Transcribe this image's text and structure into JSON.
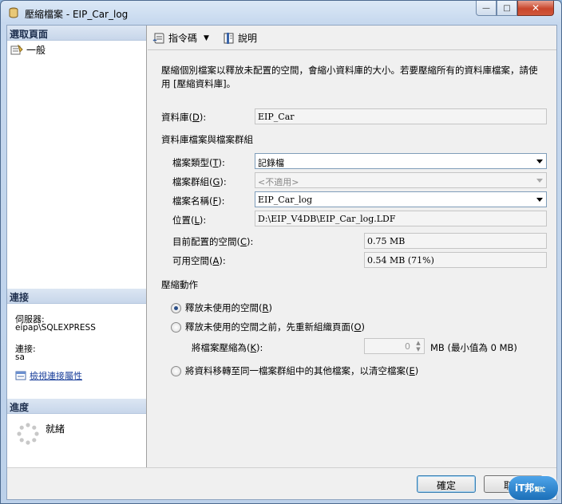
{
  "window": {
    "title": "壓縮檔案 - EIP_Car_log",
    "minimize": "—",
    "maximize": "□",
    "close": "✕"
  },
  "left": {
    "select_page_header": "選取頁面",
    "pages": [
      {
        "label": "一般"
      }
    ],
    "connection_header": "連接",
    "server_label": "伺服器:",
    "server_value": "eipap\\SQLEXPRESS",
    "connection_label": "連接:",
    "connection_value": "sa",
    "view_conn_props": "檢視連接屬性",
    "progress_header": "進度",
    "progress_status": "就緒"
  },
  "toolbar": {
    "script_label": "指令碼",
    "help_label": "說明"
  },
  "description": "壓縮個別檔案以釋放未配置的空間，會縮小資料庫的大小。若要壓縮所有的資料庫檔案，請使用 [壓縮資料庫]。",
  "database": {
    "label": "資料庫(",
    "hotkey": "D",
    "label_end": "):",
    "value": "EIP_Car"
  },
  "files_group": {
    "title": "資料庫檔案與檔案群組",
    "file_type_label": "檔案類型(",
    "file_type_key": "T",
    "file_type_end": "):",
    "file_type_value": "記錄檔",
    "filegroup_label": "檔案群組(",
    "filegroup_key": "G",
    "filegroup_end": "):",
    "filegroup_value": "<不適用>",
    "file_name_label": "檔案名稱(",
    "file_name_key": "F",
    "file_name_end": "):",
    "file_name_value": "EIP_Car_log",
    "location_label": "位置(",
    "location_key": "L",
    "location_end": "):",
    "location_value": "D:\\EIP_V4DB\\EIP_Car_log.LDF",
    "allocated_label": "目前配置的空間(",
    "allocated_key": "C",
    "allocated_end": "):",
    "allocated_value": "0.75 MB",
    "available_label": "可用空間(",
    "available_key": "A",
    "available_end": "):",
    "available_value": "0.54 MB (71%)"
  },
  "shrink_action": {
    "title": "壓縮動作",
    "option1": "釋放未使用的空間(",
    "option1_key": "R",
    "option1_end": ")",
    "option2": "釋放未使用的空間之前，先重新組織頁面(",
    "option2_key": "O",
    "option2_end": ")",
    "shrink_to_label": "將檔案壓縮為(",
    "shrink_to_key": "K",
    "shrink_to_end": "):",
    "shrink_to_value": "0",
    "shrink_to_unit": "MB (最小值為 0 MB)",
    "option3": "將資料移轉至同一檔案群組中的其他檔案，以清空檔案(",
    "option3_key": "E",
    "option3_end": ")",
    "selected": 1
  },
  "buttons": {
    "ok": "確定",
    "cancel": "取消"
  },
  "watermark": {
    "text": "iT邦",
    "sub": "幫忙"
  }
}
